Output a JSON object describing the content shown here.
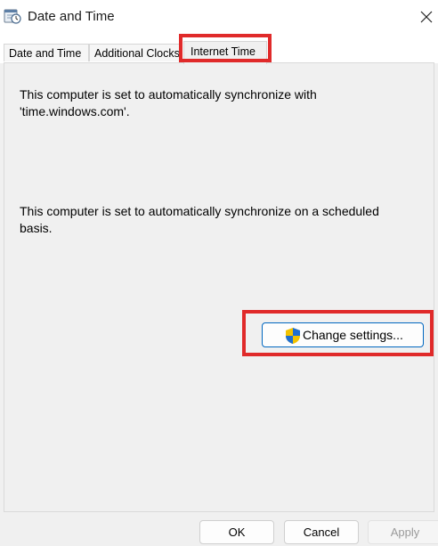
{
  "window": {
    "title": "Date and Time",
    "icon": "calendar-clock-icon",
    "close_icon": "close-icon"
  },
  "tabs": [
    {
      "label": "Date and Time",
      "active": false
    },
    {
      "label": "Additional Clocks",
      "active": false
    },
    {
      "label": "Internet Time",
      "active": true
    }
  ],
  "content": {
    "sync_server_message": "This computer is set to automatically synchronize with 'time.windows.com'.",
    "sync_schedule_message": "This computer is set to automatically synchronize on a scheduled basis.",
    "change_settings_label": "Change settings...",
    "change_settings_icon": "uac-shield-icon"
  },
  "footer": {
    "ok_label": "OK",
    "cancel_label": "Cancel",
    "apply_label": "Apply",
    "apply_enabled": false
  },
  "colors": {
    "highlight": "#e02a2a",
    "button_focus_border": "#0067c0",
    "window_bg": "#f0f0f0"
  }
}
